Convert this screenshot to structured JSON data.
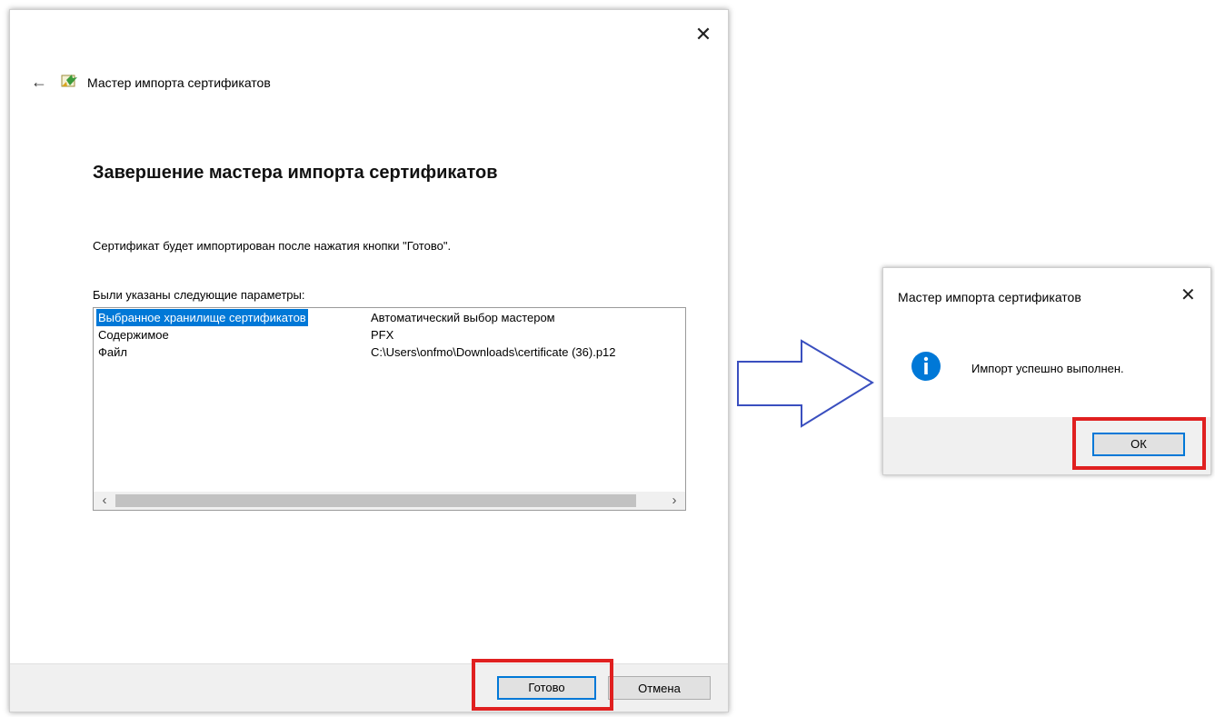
{
  "wizard": {
    "title": "Мастер импорта сертификатов",
    "heading": "Завершение мастера импорта сертификатов",
    "description": "Сертификат будет импортирован после нажатия кнопки \"Готово\".",
    "params_label": "Были указаны следующие параметры:",
    "params": [
      {
        "key": "Выбранное хранилище сертификатов",
        "value": "Автоматический выбор мастером",
        "selected": true
      },
      {
        "key": "Содержимое",
        "value": "PFX",
        "selected": false
      },
      {
        "key": "Файл",
        "value": "C:\\Users\\onfmo\\Downloads\\certificate (36).p12",
        "selected": false
      }
    ],
    "finish_label": "Готово",
    "cancel_label": "Отмена",
    "close_glyph": "✕",
    "back_glyph": "←"
  },
  "message_box": {
    "title": "Мастер импорта сертификатов",
    "text": "Импорт успешно выполнен.",
    "ok_label": "ОК",
    "close_glyph": "✕"
  },
  "colors": {
    "selection": "#0078d7",
    "highlight": "#e02020",
    "arrow": "#3a4fbf",
    "info_icon": "#0078d7"
  },
  "icons": {
    "wizard_icon": "certificate-import-icon",
    "info_icon": "info-icon",
    "back_icon": "arrow-left-icon"
  }
}
